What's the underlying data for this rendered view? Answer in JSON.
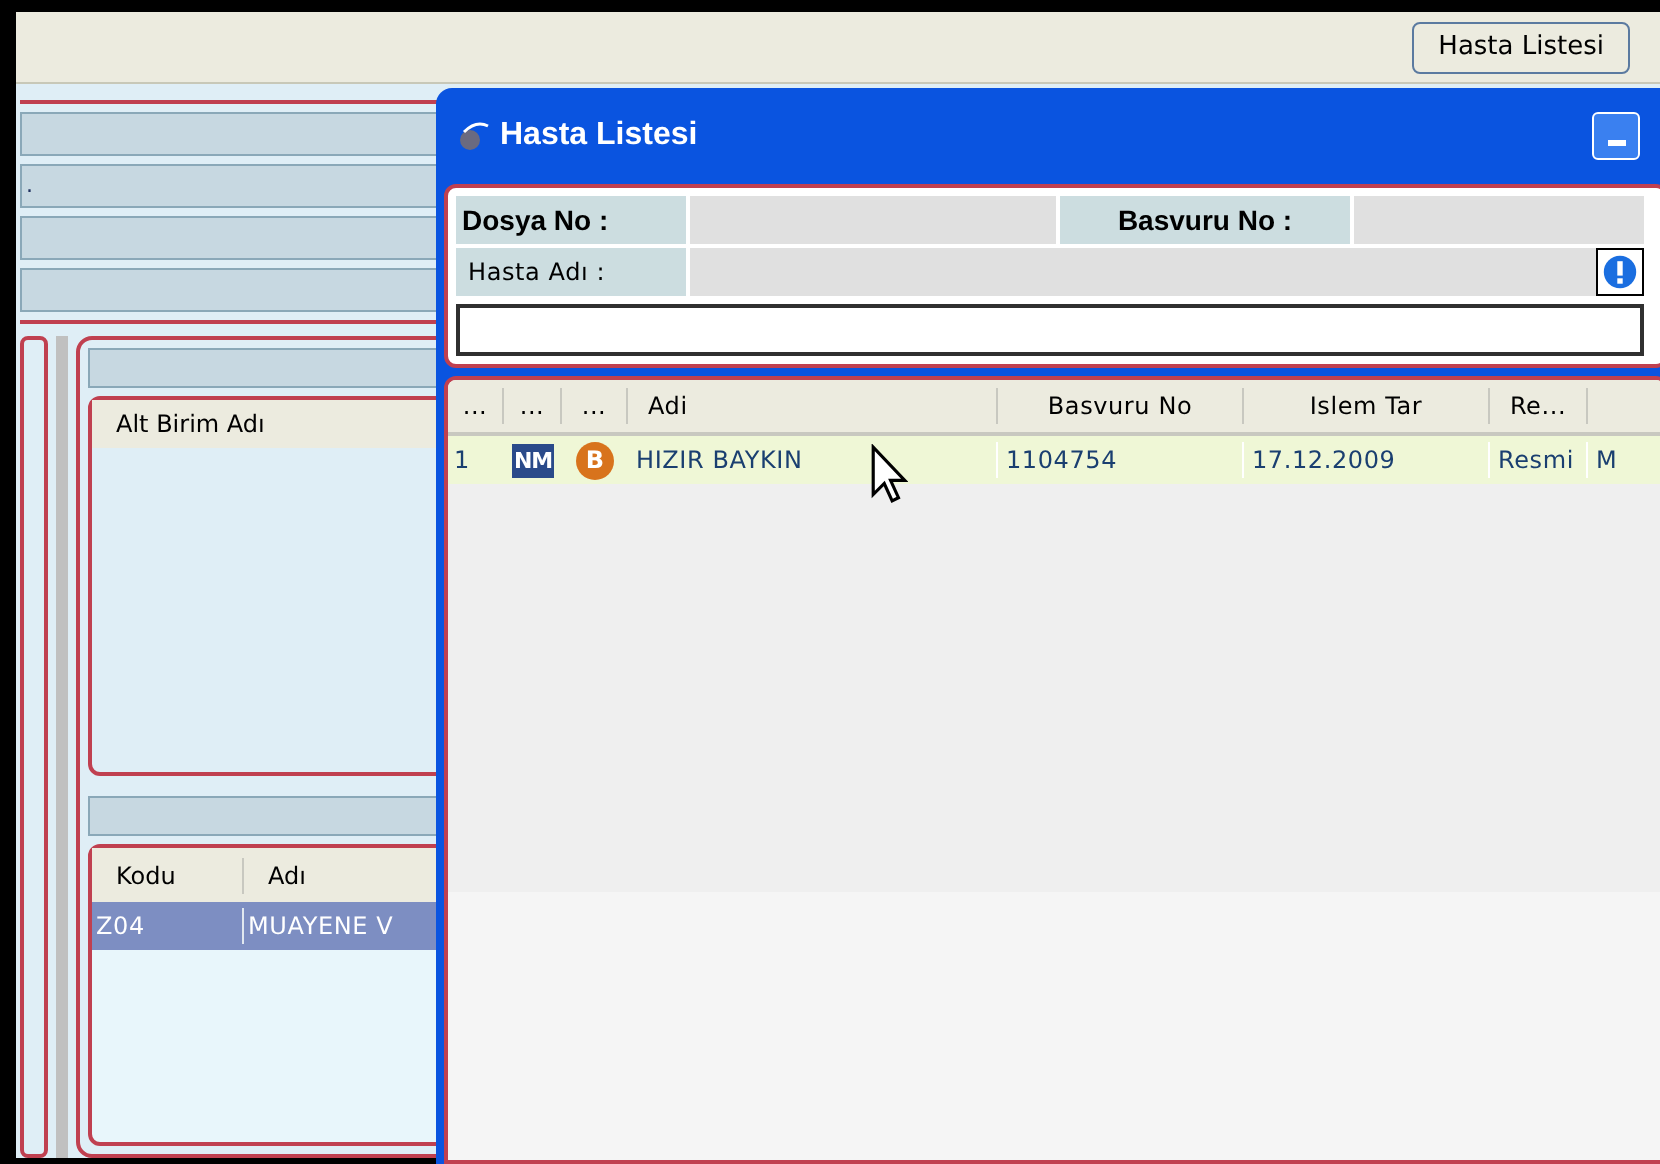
{
  "toolbar": {
    "button": "Hasta Listesi"
  },
  "background": {
    "field_text": ".",
    "sub_units": {
      "columns": [
        "Alt Birim Adı"
      ]
    },
    "services": {
      "columns": [
        "Kodu",
        "Adı"
      ],
      "rows": [
        {
          "cells": [
            "Z04",
            "MUAYENE V"
          ],
          "selected": true
        }
      ]
    }
  },
  "dialog": {
    "title": "Hasta Listesi",
    "form": {
      "dosya_label": "Dosya No :",
      "basvuru_label": "Basvuru No :",
      "hasta_label": "Hasta Adı :"
    },
    "grid": {
      "columns": [
        "...",
        "...",
        "...",
        "Adi",
        "Basvuru No",
        "Islem Tar",
        "Re..."
      ],
      "rows": [
        {
          "cells": [
            "1",
            "NM",
            "B",
            "HIZIR BAYKIN",
            "1104754",
            "17.12.2009",
            "Resmi",
            "M"
          ],
          "selected": true
        }
      ]
    }
  }
}
